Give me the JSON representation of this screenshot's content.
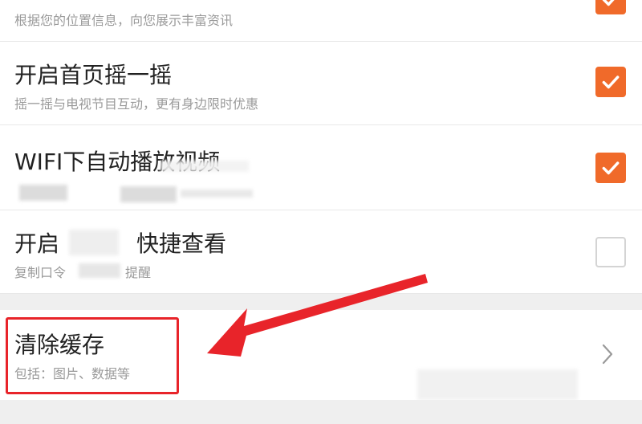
{
  "settings": {
    "items": [
      {
        "title": "",
        "subtitle": "根据您的位置信息，向您展示丰富资讯",
        "checked": true
      },
      {
        "title": "开启首页摇一摇",
        "subtitle": "摇一摇与电视节目互动，更有身边限时优惠",
        "checked": true
      },
      {
        "title": "WIFI下自动播放视频",
        "subtitle": "",
        "checked": true
      },
      {
        "title": "开启",
        "title_suffix": "快捷查看",
        "subtitle": "复制口令",
        "subtitle_suffix": "提醒",
        "checked": false
      }
    ]
  },
  "clear_cache": {
    "title": "清除缓存",
    "subtitle": "包括：图片、数据等"
  },
  "colors": {
    "accent": "#f06a2a",
    "annotation": "#e8242a"
  },
  "icons": {
    "checked": "checkmark-icon",
    "chevron": "chevron-right-icon",
    "annotation": "red-arrow-icon"
  }
}
